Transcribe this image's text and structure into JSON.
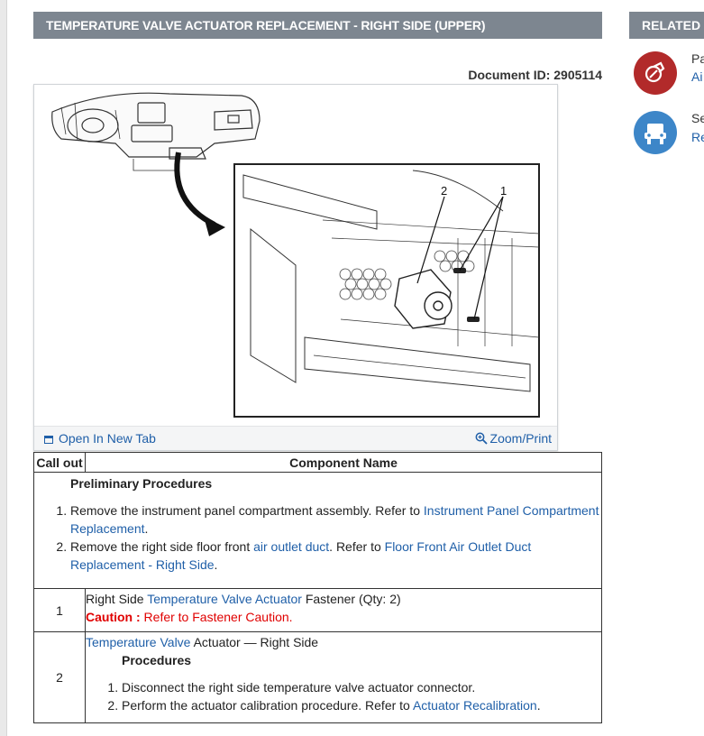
{
  "header": {
    "title": "TEMPERATURE VALVE ACTUATOR REPLACEMENT - RIGHT SIDE (UPPER)"
  },
  "document": {
    "id_text": "Document ID: 2905114"
  },
  "figure": {
    "open_new_tab": "Open In New Tab",
    "zoom_print": "Zoom/Print",
    "callout_1": "1",
    "callout_2": "2"
  },
  "table": {
    "headers": [
      "Call out",
      "Component Name"
    ],
    "preliminary": {
      "heading": "Preliminary Procedures",
      "step1_text": "Remove the instrument panel compartment assembly. Refer to ",
      "step1_link": "Instrument Panel Compartment Replacement",
      "step2_text_a": "Remove the right side floor front ",
      "step2_link_a": "air outlet duct",
      "step2_text_b": ". Refer to ",
      "step2_link_b": "Floor Front Air Outlet Duct Replacement - Right Side"
    },
    "row1": {
      "callout": "1",
      "text_a": "Right Side ",
      "link": "Temperature Valve Actuator",
      "text_b": " Fastener (Qty: 2)",
      "caution_label": "Caution : ",
      "caution_text": "Refer to ",
      "caution_link": "Fastener Caution"
    },
    "row2": {
      "callout": "2",
      "link": "Temperature Valve",
      "text": " Actuator — Right Side",
      "proc_heading": "Procedures",
      "step1": "Disconnect the right side temperature valve actuator connector.",
      "step2_text": "Perform the actuator calibration procedure. Refer to ",
      "step2_link": "Actuator Recalibration"
    }
  },
  "related": {
    "header": "RELATED IN",
    "items": [
      {
        "title": "Pa",
        "link": "Ai",
        "icon": "parts-icon",
        "color": "#b22a2a"
      },
      {
        "title": "Se",
        "link": "Re",
        "icon": "service-icon",
        "color": "#3d86c8"
      }
    ]
  },
  "colors": {
    "header_bar": "#7d8690",
    "link": "#1f5fa8",
    "caution": "#e00000"
  }
}
